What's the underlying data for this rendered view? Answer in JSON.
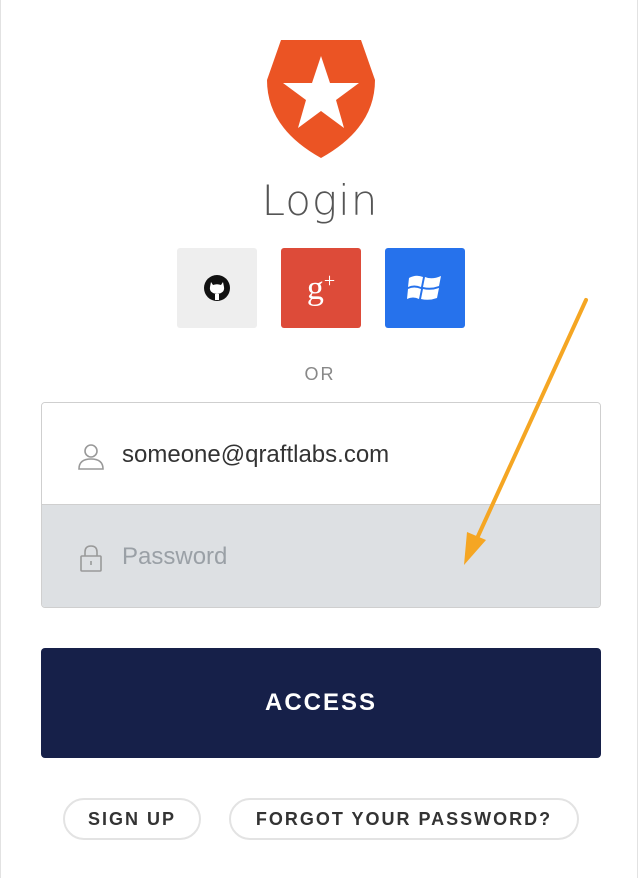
{
  "header": {
    "title": "Login"
  },
  "social": {
    "github_icon": "github-icon",
    "google_label": "g",
    "google_sup": "+",
    "windows_icon": "windows-icon"
  },
  "divider": {
    "label": "OR"
  },
  "form": {
    "email_value": "someone@qraftlabs.com",
    "password_placeholder": "Password",
    "submit_label": "ACCESS"
  },
  "footer": {
    "signup_label": "SIGN UP",
    "forgot_label": "FORGOT YOUR PASSWORD?"
  },
  "colors": {
    "brand": "#eb5424",
    "google": "#dd4b39",
    "windows": "#2672ec",
    "submit_bg": "#162049",
    "annotation_arrow": "#f5a623"
  }
}
